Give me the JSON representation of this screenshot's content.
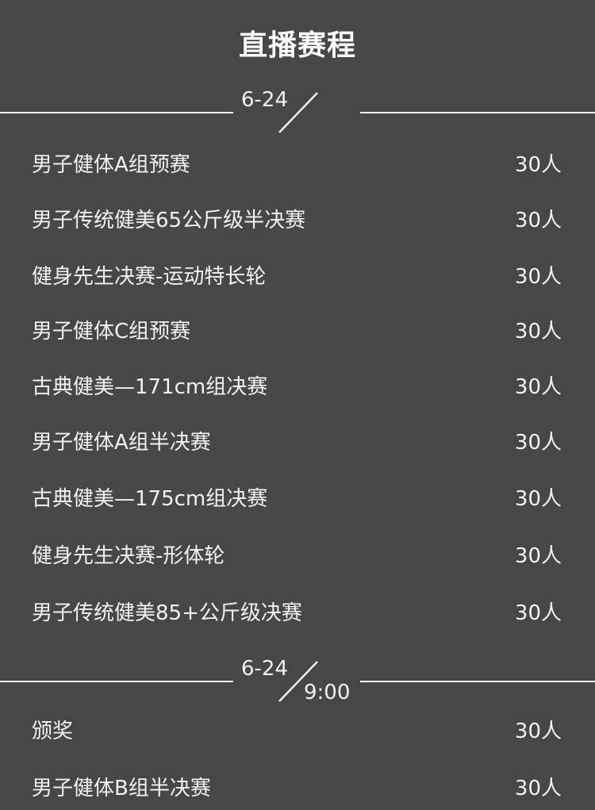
{
  "header": {
    "title": "直播赛程"
  },
  "sections": [
    {
      "date": "6-24",
      "time": "",
      "items": [
        {
          "name": "男子健体A组预赛",
          "count": "30人"
        },
        {
          "name": "男子传统健美65公斤级半决赛",
          "count": "30人"
        },
        {
          "name": "健身先生决赛-运动特长轮",
          "count": "30人"
        },
        {
          "name": "男子健体C组预赛",
          "count": "30人"
        },
        {
          "name": "古典健美—171cm组决赛",
          "count": "30人"
        },
        {
          "name": "男子健体A组半决赛",
          "count": "30人"
        },
        {
          "name": "古典健美—175cm组决赛",
          "count": "30人"
        },
        {
          "name": "健身先生决赛-形体轮",
          "count": "30人"
        },
        {
          "name": "男子传统健美85+公斤级决赛",
          "count": "30人"
        }
      ]
    },
    {
      "date": "6-24",
      "time": "9:00",
      "items": [
        {
          "name": "颁奖",
          "count": "30人"
        },
        {
          "name": "男子健体B组半决赛",
          "count": "30人"
        }
      ]
    }
  ],
  "colors": {
    "background": "#474747",
    "text": "#f2f2f2",
    "divider": "#f0f0f0"
  }
}
